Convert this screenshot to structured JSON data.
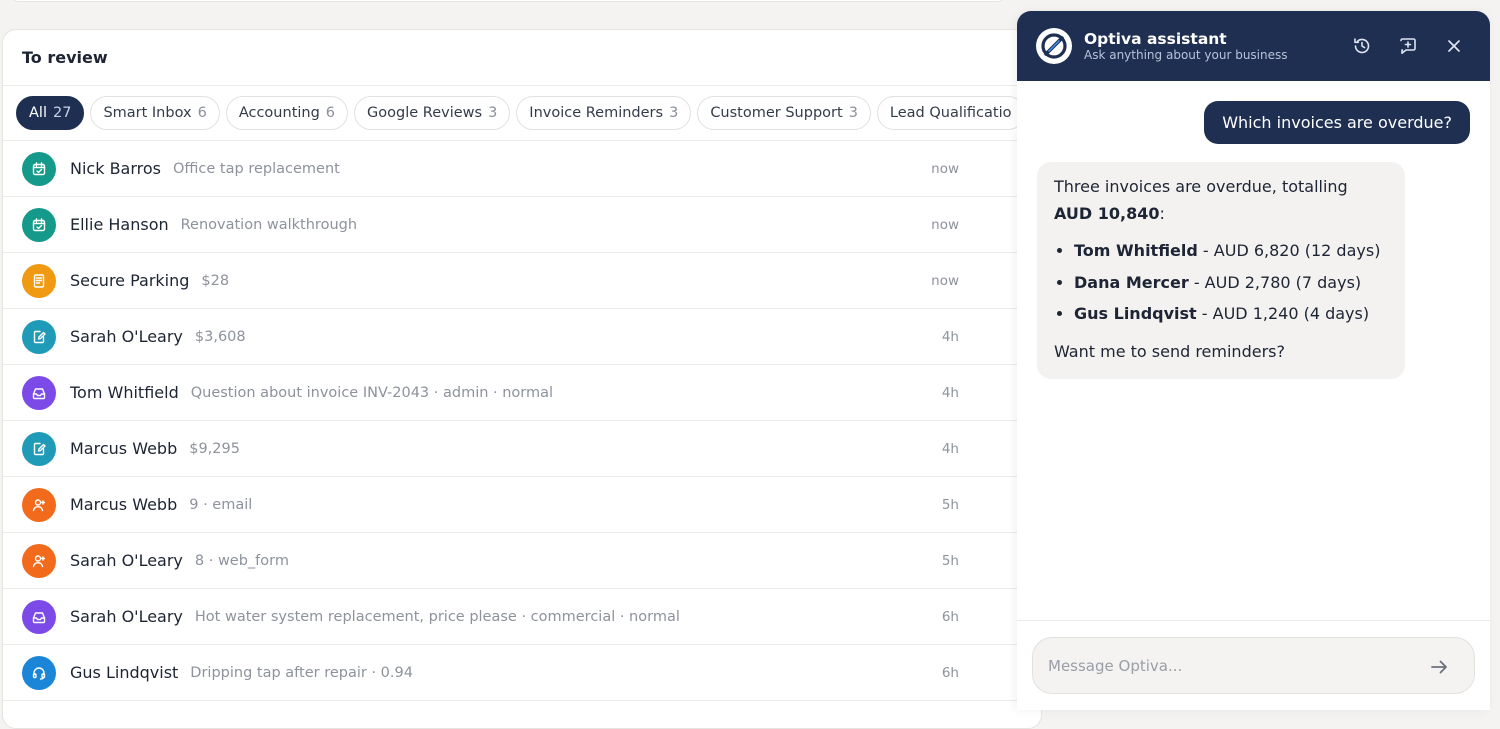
{
  "review": {
    "title": "To review",
    "chips": [
      {
        "label": "All",
        "count": "27",
        "active": true
      },
      {
        "label": "Smart Inbox",
        "count": "6"
      },
      {
        "label": "Accounting",
        "count": "6"
      },
      {
        "label": "Google Reviews",
        "count": "3"
      },
      {
        "label": "Invoice Reminders",
        "count": "3"
      },
      {
        "label": "Customer Support",
        "count": "3"
      },
      {
        "label": "Lead Qualificatio"
      }
    ],
    "rows": [
      {
        "name": "Nick Barros",
        "sub": "Office tap replacement",
        "time": "now",
        "icon": "calendar-icon",
        "color": "#14998a"
      },
      {
        "name": "Ellie Hanson",
        "sub": "Renovation walkthrough",
        "time": "now",
        "icon": "calendar-icon",
        "color": "#14998a"
      },
      {
        "name": "Secure Parking",
        "sub": "$28",
        "time": "now",
        "icon": "receipt-icon",
        "color": "#ef9a12"
      },
      {
        "name": "Sarah O'Leary",
        "sub": "$3,608",
        "time": "4h",
        "icon": "edit-document-icon",
        "color": "#1f9bb8"
      },
      {
        "name": "Tom Whitfield",
        "sub": "Question about invoice INV-2043 · admin · normal",
        "time": "4h",
        "icon": "inbox-icon",
        "color": "#7c4ae6"
      },
      {
        "name": "Marcus Webb",
        "sub": "$9,295",
        "time": "4h",
        "icon": "edit-document-icon",
        "color": "#1f9bb8"
      },
      {
        "name": "Marcus Webb",
        "sub": "9 · email",
        "time": "5h",
        "icon": "user-icon",
        "color": "#f26a1b"
      },
      {
        "name": "Sarah O'Leary",
        "sub": "8 · web_form",
        "time": "5h",
        "icon": "user-icon",
        "color": "#f26a1b"
      },
      {
        "name": "Sarah O'Leary",
        "sub": "Hot water system replacement, price please · commercial · normal",
        "time": "6h",
        "icon": "inbox-icon",
        "color": "#7c4ae6"
      },
      {
        "name": "Gus Lindqvist",
        "sub": "Dripping tap after repair · 0.94",
        "time": "6h",
        "icon": "headset-icon",
        "color": "#1b86d8"
      }
    ]
  },
  "assistant": {
    "title": "Optiva assistant",
    "subtitle": "Ask anything about your business",
    "user_message": "Which invoices are overdue?",
    "reply": {
      "intro_prefix": "Three invoices are overdue, totalling ",
      "intro_total": "AUD 10,840",
      "intro_suffix": ":",
      "items": [
        {
          "name": "Tom Whitfield",
          "detail": " - AUD 6,820 (12 days)"
        },
        {
          "name": "Dana Mercer",
          "detail": " - AUD 2,780 (7 days)"
        },
        {
          "name": "Gus Lindqvist",
          "detail": " - AUD 1,240 (4 days)"
        }
      ],
      "closing": "Want me to send reminders?"
    },
    "composer_placeholder": "Message Optiva..."
  },
  "colors": {
    "navy": "#1e2f52",
    "teal": "#14998a",
    "amber": "#ef9a12",
    "cyan": "#1f9bb8",
    "purple": "#7c4ae6",
    "orange": "#f26a1b",
    "blue": "#1b86d8"
  }
}
